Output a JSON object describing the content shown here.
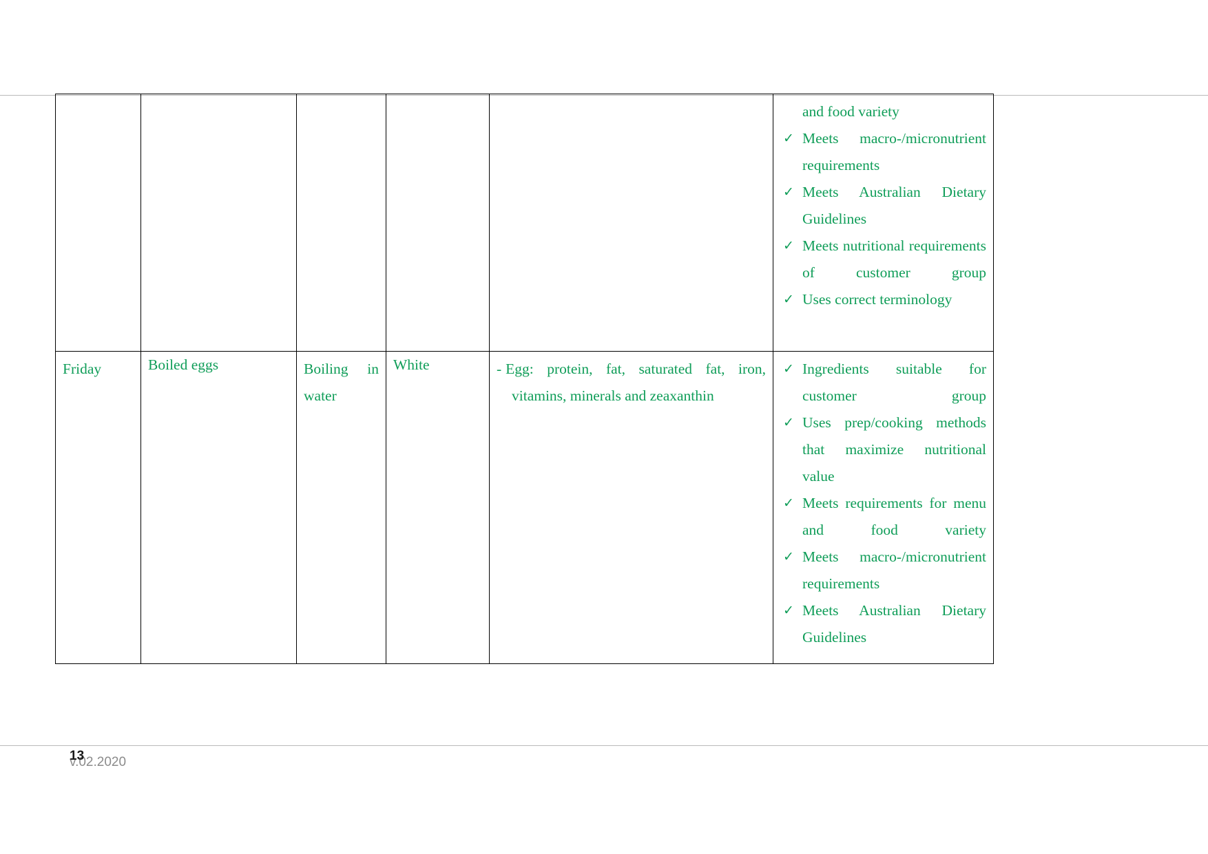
{
  "document": {
    "footer": {
      "page_number": "13",
      "version": "v.02.2020"
    },
    "accent_color": "#0f9d58",
    "border_color": "#000000"
  },
  "table": {
    "rows": [
      {
        "name": "continued-row",
        "day": "",
        "dish": "",
        "method": "",
        "colour": "",
        "nutrients": [],
        "checklist_continuation": "and food variety",
        "checklist": [
          "Meets macro-/micronutrient requirements",
          "Meets Australian Dietary Guidelines",
          "Meets nutritional requirements of customer group",
          "Uses correct terminology"
        ]
      },
      {
        "name": "friday-row",
        "day": "Friday",
        "dish": "Boiled eggs",
        "method": "Boiling in water",
        "colour": "White",
        "nutrients": [
          "Egg: protein, fat, saturated fat, iron, vitamins, minerals and zeaxanthin"
        ],
        "checklist_continuation": "",
        "checklist": [
          "Ingredients suitable for customer group",
          "Uses prep/cooking methods that maximize nutritional value",
          "Meets requirements for menu and food variety",
          "Meets macro-/micronutrient requirements",
          "Meets Australian Dietary Guidelines"
        ]
      }
    ]
  },
  "icons": {
    "check": "✓",
    "dash": "-"
  }
}
